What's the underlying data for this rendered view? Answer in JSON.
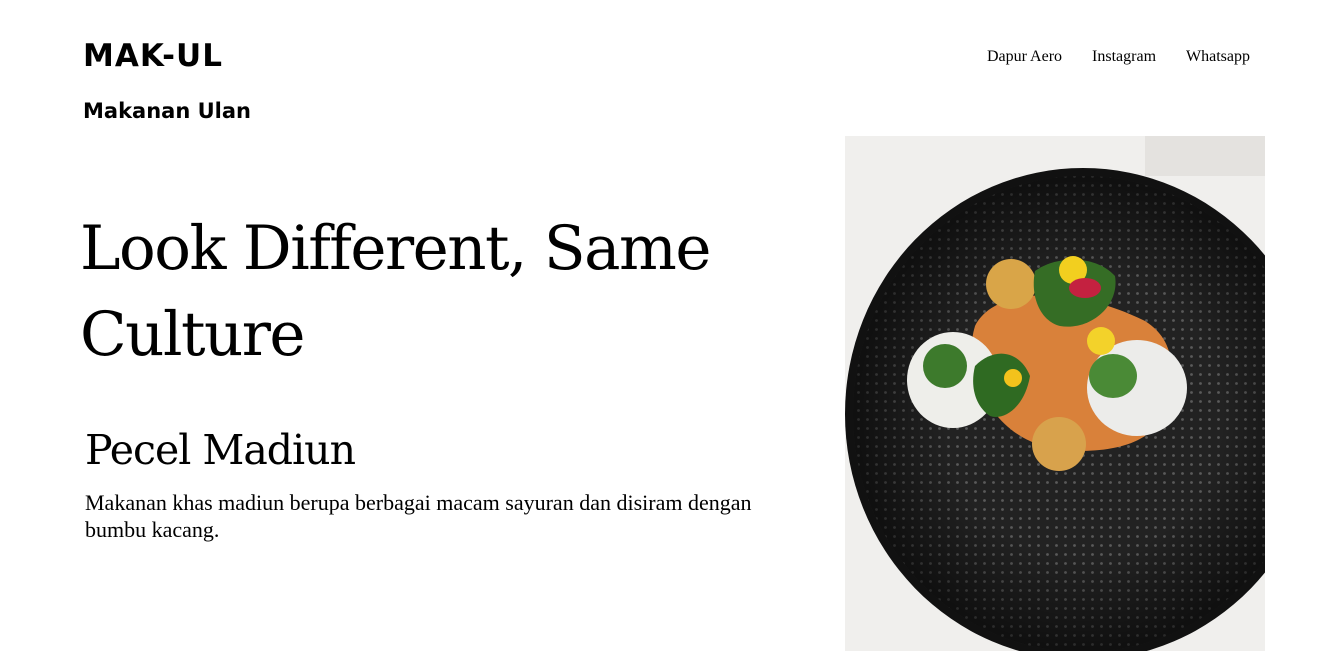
{
  "header": {
    "brand": "MAK-UL",
    "tagline": "Makanan Ulan"
  },
  "nav": {
    "items": [
      {
        "label": "Dapur Aero"
      },
      {
        "label": "Instagram"
      },
      {
        "label": "Whatsapp"
      }
    ]
  },
  "hero": {
    "title": "Look Different, Same Culture"
  },
  "dish": {
    "name": "Pecel Madiun",
    "description": "Makanan khas madiun berupa berbagai macam sayuran dan disiram dengan bumbu kacang."
  },
  "photo": {
    "subject": "food-plate-image"
  },
  "colors": {
    "background": "#ffffff",
    "text": "#000000",
    "plate": "#1f1f1f",
    "sauce": "#e0873a"
  }
}
